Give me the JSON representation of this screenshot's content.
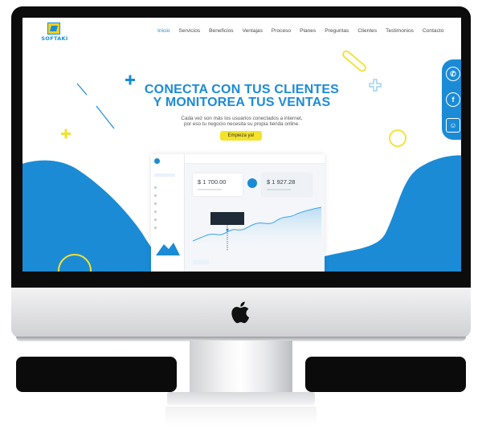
{
  "brand": {
    "name": "SOFTAKI"
  },
  "nav": {
    "items": [
      "Inicio",
      "Servicios",
      "Beneficios",
      "Ventajas",
      "Proceso",
      "Planes",
      "Preguntas",
      "Clientes",
      "Testimonios",
      "Contacto"
    ],
    "active": "Inicio"
  },
  "hero": {
    "title_line1": "CONECTA CON TUS CLIENTES",
    "title_line2": "Y MONITOREA TUS VENTAS",
    "subtitle_line1": "Cada vez son más los usuarios conectados a internet,",
    "subtitle_line2": "por eso tu negocio necesita su propia tienda online.",
    "cta_label": "Empieza ya!"
  },
  "social": {
    "icons": [
      "whatsapp-icon",
      "facebook-icon",
      "contact-card-icon"
    ]
  },
  "dashboard": {
    "card1_value": "$ 1 700.00",
    "card2_value": "$ 1 927.28"
  },
  "colors": {
    "accent": "#1b8bd6",
    "cta": "#f3e32a",
    "deco_yellow": "#f2e22a"
  }
}
